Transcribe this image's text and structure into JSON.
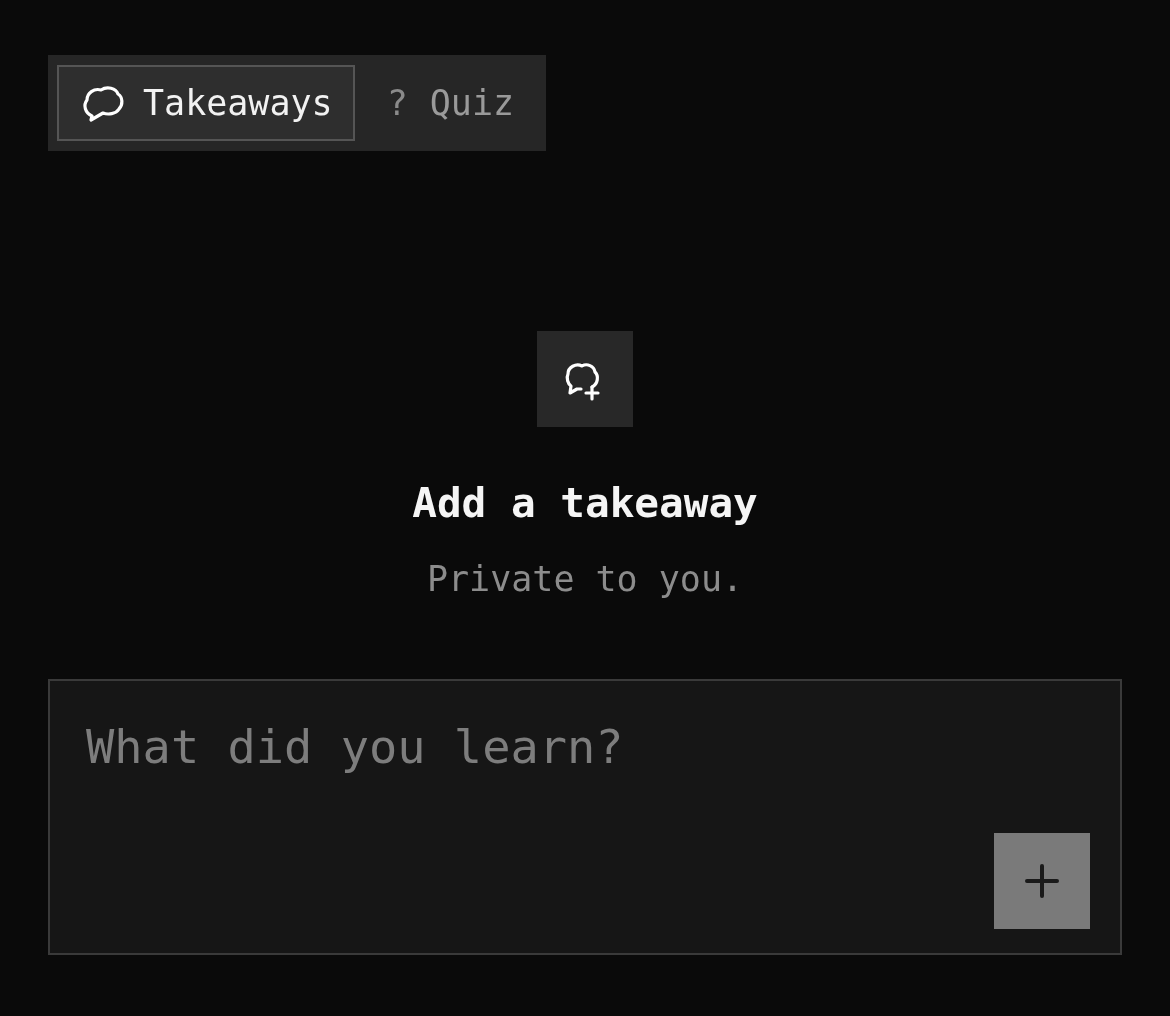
{
  "tabs": [
    {
      "label": "Takeaways",
      "selected": true,
      "kind": "icon"
    },
    {
      "label": "Quiz",
      "selected": false,
      "kind": "glyph",
      "glyph": "?"
    }
  ],
  "empty_state": {
    "title": "Add a takeaway",
    "subtitle": "Private to you."
  },
  "composer": {
    "placeholder": "What did you learn?"
  }
}
